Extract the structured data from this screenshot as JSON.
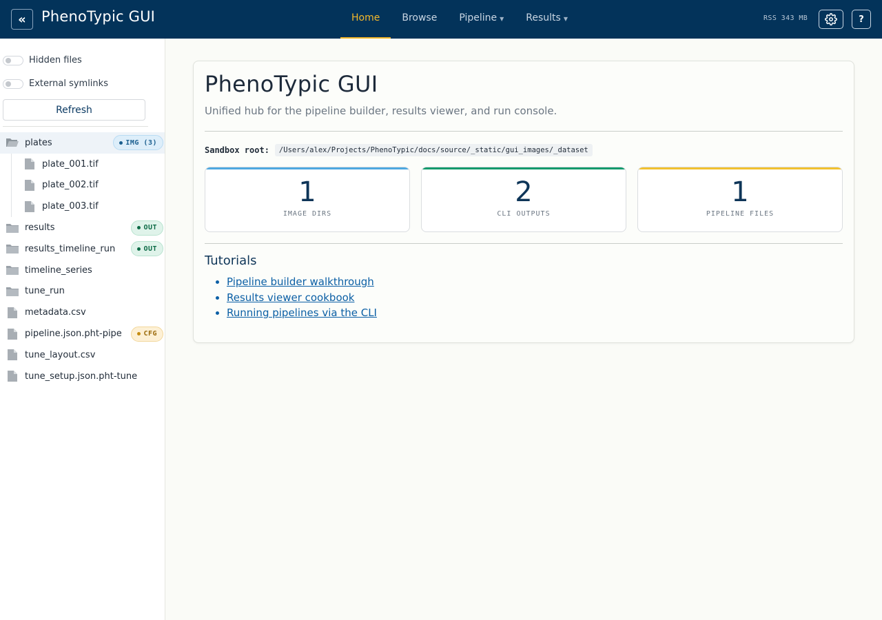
{
  "header": {
    "collapse_label": "«",
    "title": "PhenoTypic GUI",
    "nav": [
      {
        "label": "Home",
        "active": true,
        "dropdown": false
      },
      {
        "label": "Browse",
        "active": false,
        "dropdown": false
      },
      {
        "label": "Pipeline",
        "active": false,
        "dropdown": true
      },
      {
        "label": "Results",
        "active": false,
        "dropdown": true
      }
    ],
    "rss": "RSS 343 MB",
    "help_label": "?",
    "settings_icon": "gear-icon",
    "colors": {
      "bar": "#03335a",
      "accent": "#f5b92a"
    }
  },
  "sidebar": {
    "toggles": [
      {
        "label": "Hidden files",
        "checked": false
      },
      {
        "label": "External symlinks",
        "checked": false
      }
    ],
    "refresh_label": "Refresh",
    "tree": [
      {
        "name": "plates",
        "type": "folder-open",
        "level": 0,
        "selected": true,
        "badge": {
          "kind": "img",
          "text": "IMG (3)"
        }
      },
      {
        "name": "plate_001.tif",
        "type": "file",
        "level": 1
      },
      {
        "name": "plate_002.tif",
        "type": "file",
        "level": 1
      },
      {
        "name": "plate_003.tif",
        "type": "file",
        "level": 1
      },
      {
        "name": "results",
        "type": "folder",
        "level": 0,
        "badge": {
          "kind": "out",
          "text": "OUT"
        }
      },
      {
        "name": "results_timeline_run",
        "type": "folder",
        "level": 0,
        "badge": {
          "kind": "out",
          "text": "OUT"
        }
      },
      {
        "name": "timeline_series",
        "type": "folder",
        "level": 0
      },
      {
        "name": "tune_run",
        "type": "folder",
        "level": 0
      },
      {
        "name": "metadata.csv",
        "type": "file",
        "level": 0
      },
      {
        "name": "pipeline.json.pht-pipe",
        "type": "file",
        "level": 0,
        "badge": {
          "kind": "cfg",
          "text": "CFG"
        }
      },
      {
        "name": "tune_layout.csv",
        "type": "file",
        "level": 0
      },
      {
        "name": "tune_setup.json.pht-tune",
        "type": "file",
        "level": 0
      }
    ]
  },
  "main": {
    "title": "PhenoTypic GUI",
    "subtitle": "Unified hub for the pipeline builder, results viewer, and run console.",
    "sandbox_label": "Sandbox root:",
    "sandbox_path": "/Users/alex/Projects/PhenoTypic/docs/source/_static/gui_images/_dataset",
    "stats": [
      {
        "value": "1",
        "label": "IMAGE DIRS",
        "color": "#4ea8e0"
      },
      {
        "value": "2",
        "label": "CLI OUTPUTS",
        "color": "#119a6c"
      },
      {
        "value": "1",
        "label": "PIPELINE FILES",
        "color": "#f2c12e"
      }
    ],
    "tutorials_title": "Tutorials",
    "tutorials": [
      "Pipeline builder walkthrough",
      "Results viewer cookbook",
      "Running pipelines via the CLI"
    ]
  }
}
